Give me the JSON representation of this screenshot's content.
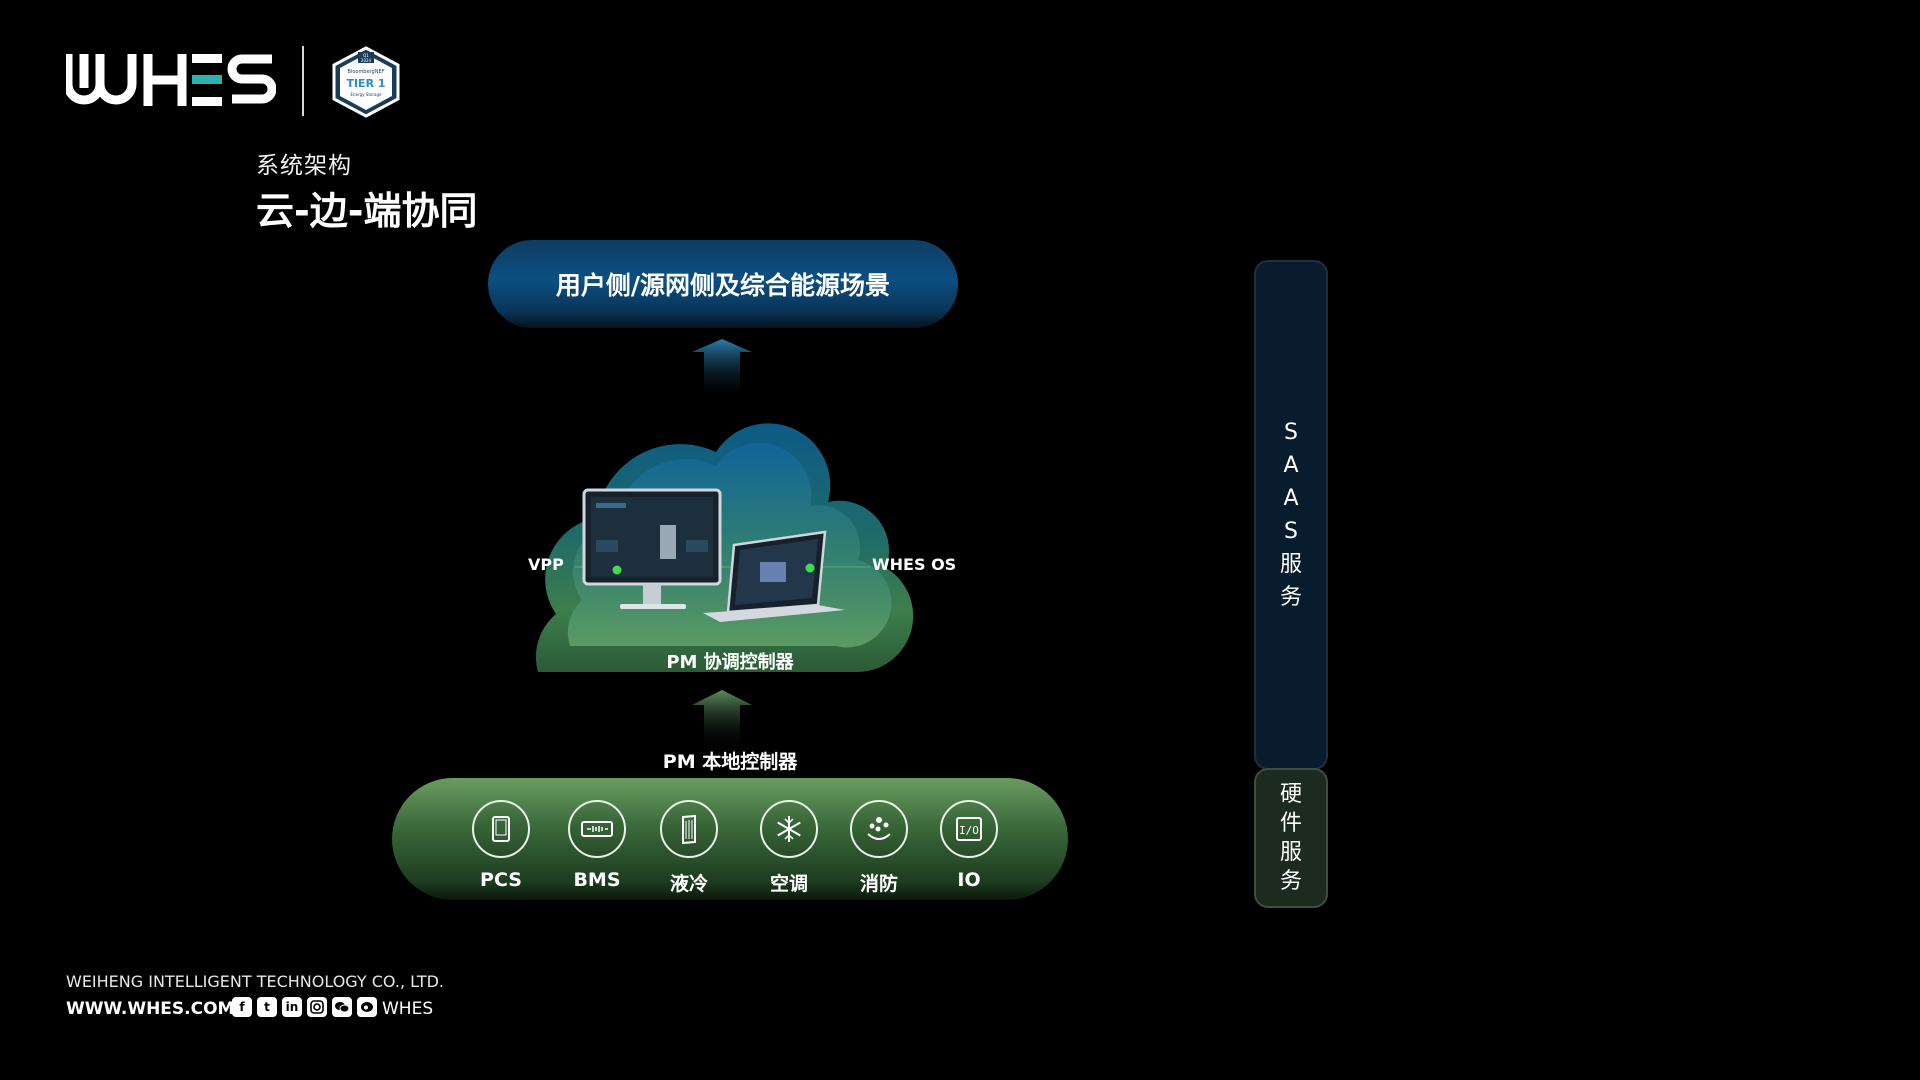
{
  "header": {
    "logo_text": "WHES",
    "badge": {
      "line1": "Q1",
      "line2": "2024",
      "line3": "BloombergNEF",
      "line4": "TIER 1",
      "line5": "Energy Storage"
    },
    "subtitle": "系统架构",
    "title": "云-边-端协同"
  },
  "diagram": {
    "scenario": "用户侧/源网侧及综合能源场景",
    "cloud_left": "VPP",
    "cloud_right": "WHES OS",
    "pm_coordinator": "PM 协调控制器",
    "pm_local": "PM 本地控制器",
    "devices": [
      {
        "icon": "pcs-icon",
        "label": "PCS"
      },
      {
        "icon": "bms-icon",
        "label": "BMS"
      },
      {
        "icon": "liquid-cooling-icon",
        "label": "液冷"
      },
      {
        "icon": "snowflake-icon",
        "label": "空调"
      },
      {
        "icon": "fire-protection-icon",
        "label": "消防"
      },
      {
        "icon": "io-icon",
        "label": "IO"
      }
    ]
  },
  "sidebar": {
    "saas": [
      "S",
      "A",
      "A",
      "S",
      "服",
      "务"
    ],
    "hardware": [
      "硬",
      "件",
      "服",
      "务"
    ]
  },
  "footer": {
    "company": "WEIHENG INTELLIGENT TECHNOLOGY CO., LTD.",
    "website": "WWW.WHES.COM",
    "socials": [
      "facebook-icon",
      "twitter-icon",
      "linkedin-icon",
      "instagram-icon",
      "wechat-icon",
      "weibo-icon"
    ],
    "brand": "WHES"
  },
  "colors": {
    "background": "#000000",
    "accent_blue": "#0c4f81",
    "accent_green": "#3a6a3a",
    "logo_teal": "#2bb3b0"
  }
}
